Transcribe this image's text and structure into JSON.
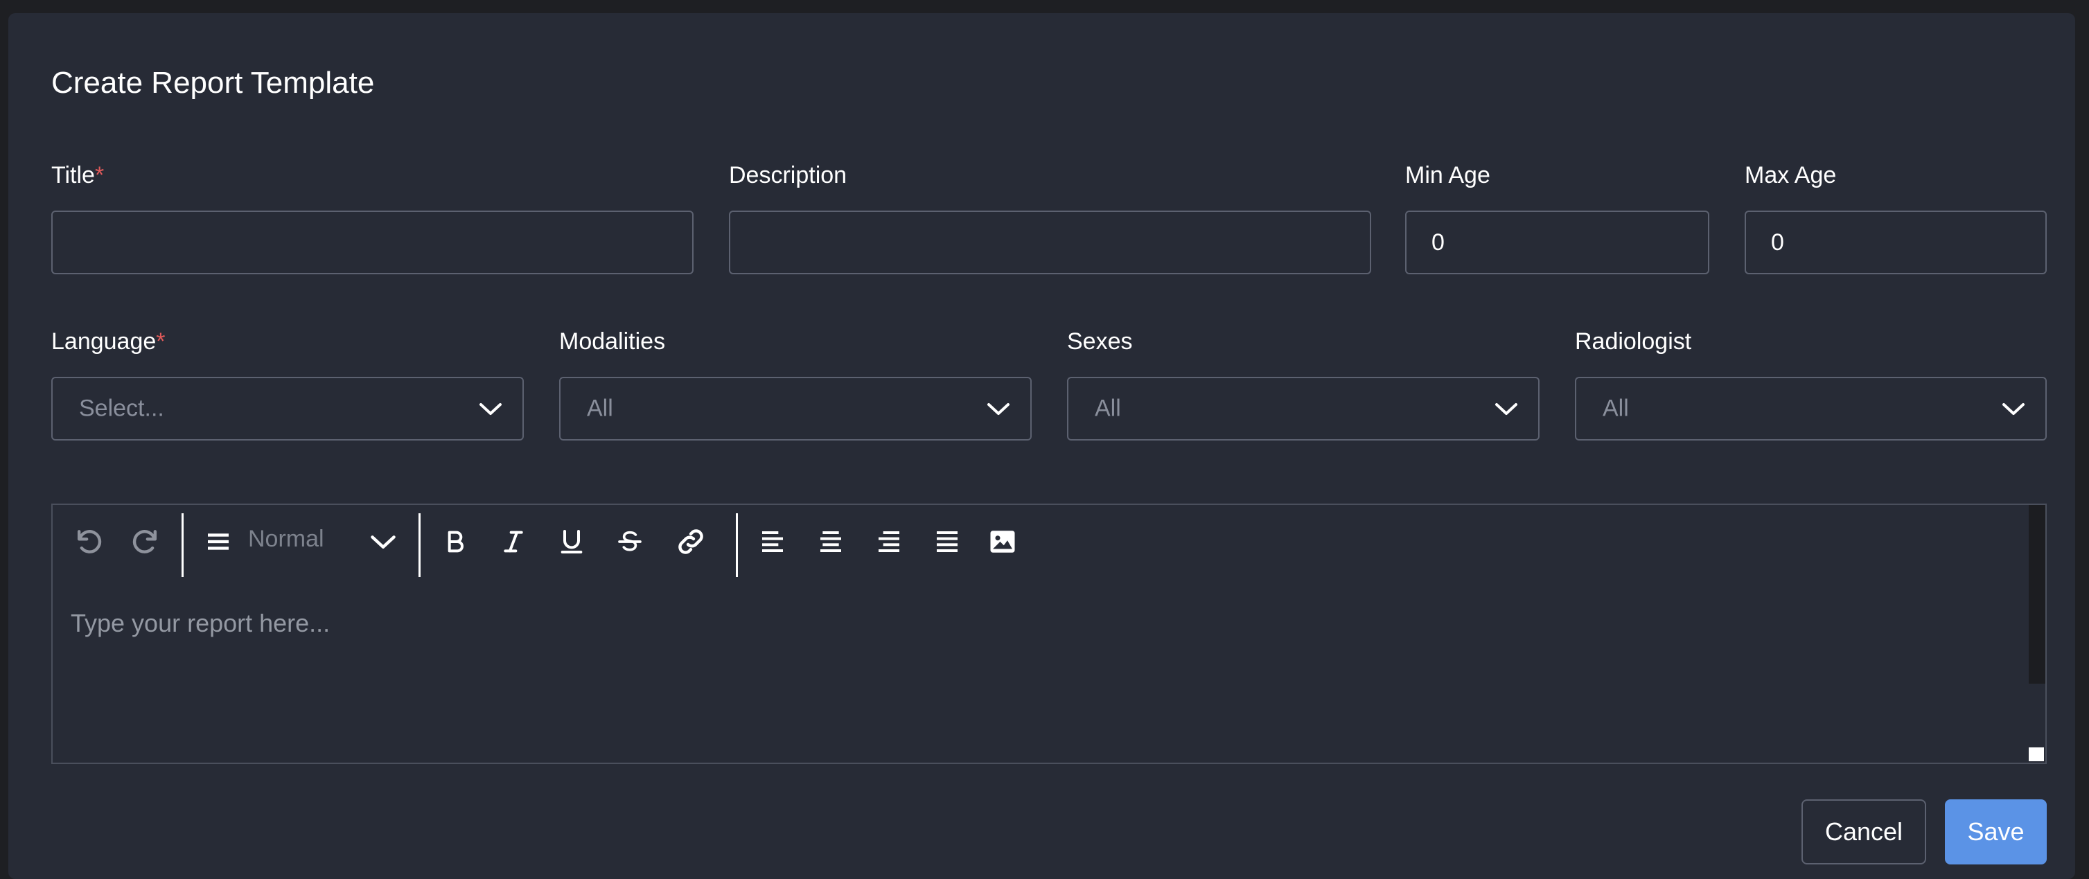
{
  "dialog": {
    "title": "Create Report Template"
  },
  "fields": {
    "title": {
      "label": "Title",
      "required_mark": "*",
      "value": ""
    },
    "description": {
      "label": "Description",
      "value": ""
    },
    "min_age": {
      "label": "Min Age",
      "value": "0"
    },
    "max_age": {
      "label": "Max Age",
      "value": "0"
    },
    "language": {
      "label": "Language",
      "required_mark": "*",
      "selected": "Select..."
    },
    "modalities": {
      "label": "Modalities",
      "selected": "All"
    },
    "sexes": {
      "label": "Sexes",
      "selected": "All"
    },
    "radiologist": {
      "label": "Radiologist",
      "selected": "All"
    }
  },
  "editor": {
    "format_dropdown": "Normal",
    "placeholder": "Type your report here...",
    "toolbar_icons": [
      "undo-icon",
      "redo-icon",
      "paragraph-format-icon",
      "chevron-down-icon",
      "bold-icon",
      "italic-icon",
      "underline-icon",
      "strikethrough-icon",
      "link-icon",
      "align-left-icon",
      "align-center-icon",
      "align-right-icon",
      "align-justify-icon",
      "image-icon"
    ]
  },
  "actions": {
    "cancel_label": "Cancel",
    "save_label": "Save"
  },
  "colors": {
    "background": "#272b36",
    "border": "#5c6170",
    "required": "#e05a5a",
    "primary": "#5b93e6",
    "placeholder": "#8a8f9c"
  }
}
